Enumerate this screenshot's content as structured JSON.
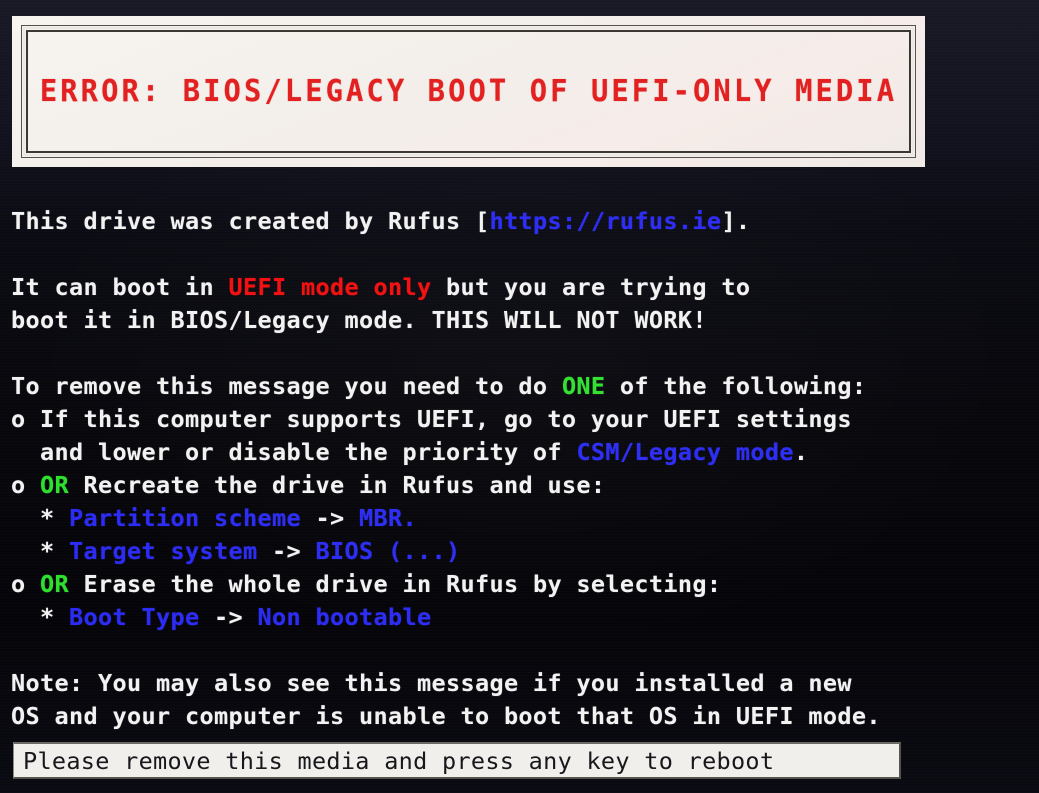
{
  "screen": {
    "background_color": "#08080f",
    "text_color": "#f2f2f2",
    "accent_red": "#f30d0d",
    "accent_blue": "#2b2bf5",
    "accent_green": "#2ee02e"
  },
  "banner": {
    "title": "ERROR: BIOS/LEGACY BOOT OF UEFI-ONLY MEDIA",
    "title_color": "#e32020",
    "background_color": "#f5f1ed"
  },
  "body": {
    "line1": {
      "a": "This drive was created by Rufus [",
      "url": "https://rufus.ie",
      "b": "]."
    },
    "line2": {
      "a": "It can boot in ",
      "emphasis": "UEFI mode only",
      "b": " but you are trying to"
    },
    "line3": "boot it in BIOS/Legacy mode. THIS WILL NOT WORK!",
    "line4": {
      "a": "To remove this message you need to do ",
      "emphasis": "ONE",
      "b": " of the following:"
    },
    "line5": "o If this computer supports UEFI, go to your UEFI settings",
    "line6": {
      "a": "  and lower or disable the priority of ",
      "emphasis": "CSM/Legacy mode",
      "b": "."
    },
    "line7": {
      "bullet": "o ",
      "emphasis": "OR",
      "b": " Recreate the drive in Rufus and use:"
    },
    "line8": {
      "bullet": "  * ",
      "option": "Partition scheme",
      "arrow": " -> ",
      "value": "MBR",
      "suffix": "."
    },
    "line9": {
      "bullet": "  * ",
      "option": "Target system",
      "arrow": " -> ",
      "value": "BIOS (...)",
      "suffix": ""
    },
    "line10": {
      "bullet": "o ",
      "emphasis": "OR",
      "b": " Erase the whole drive in Rufus by selecting:"
    },
    "line11": {
      "bullet": "  * ",
      "option": "Boot Type",
      "arrow": " -> ",
      "value": "Non bootable",
      "suffix": ""
    },
    "line12": "Note: You may also see this message if you installed a new",
    "line13": "OS and your computer is unable to boot that OS in UEFI mode."
  },
  "prompt": {
    "text": "Please remove this media and press any key to reboot"
  }
}
